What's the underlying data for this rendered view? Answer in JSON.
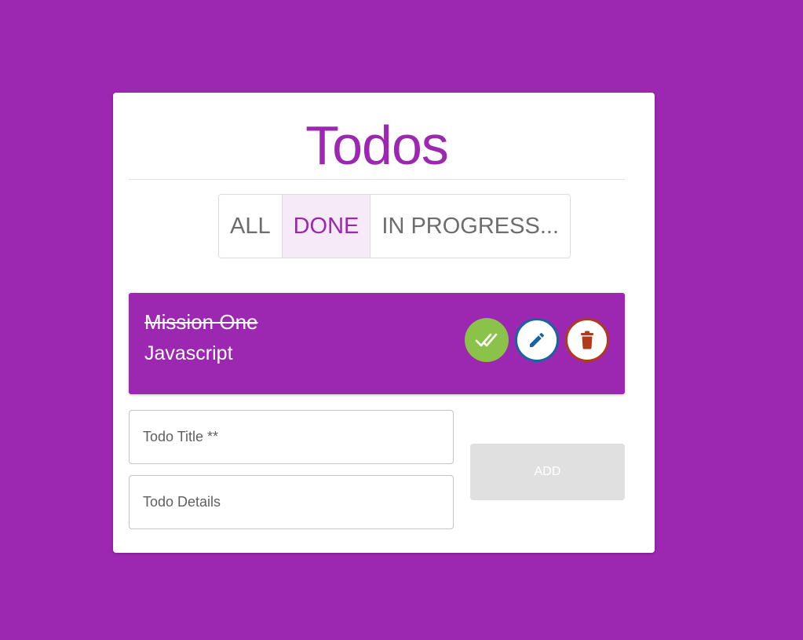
{
  "app": {
    "title": "Todos"
  },
  "filters": [
    {
      "label": "ALL",
      "active": false
    },
    {
      "label": "DONE",
      "active": true
    },
    {
      "label": "IN PROGRESS...",
      "active": false
    }
  ],
  "todos": [
    {
      "title": "Mission One",
      "details": "Javascript",
      "done": true
    }
  ],
  "form": {
    "title_placeholder": "Todo Title **",
    "details_placeholder": "Todo Details",
    "add_label": "ADD"
  },
  "icons": {
    "done": "double-check-icon",
    "edit": "pencil-icon",
    "delete": "trash-icon"
  },
  "colors": {
    "background": "#9c27b0",
    "accent": "#9c27b0",
    "done_button": "#8bc34a",
    "edit_button": "#1565a0",
    "delete_button": "#b23a1c",
    "add_button_disabled": "#e0e0e0"
  }
}
